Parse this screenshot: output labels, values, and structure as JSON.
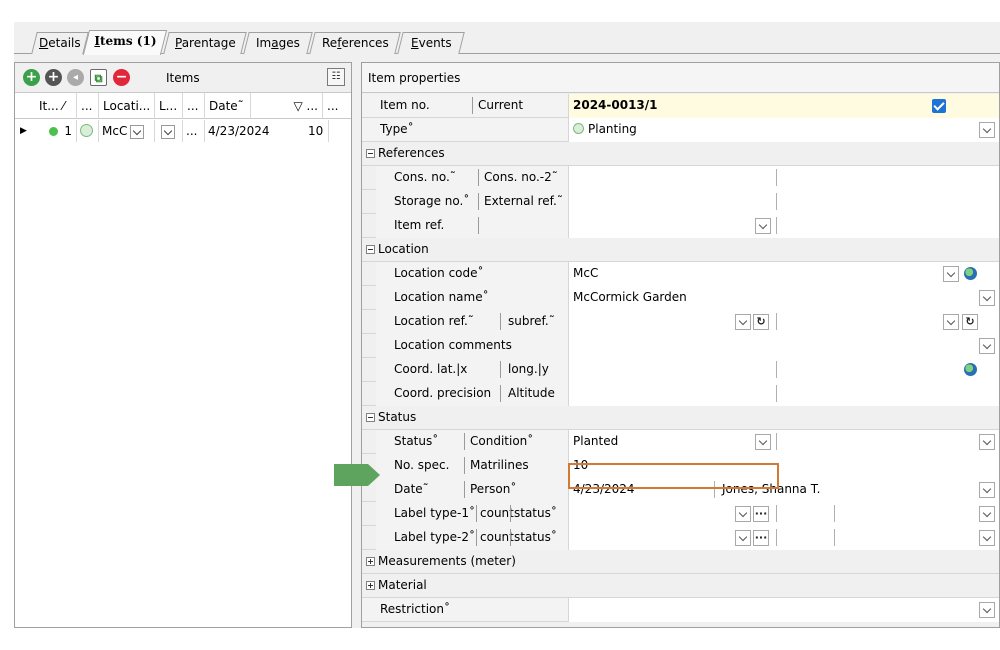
{
  "tabs": [
    {
      "label": "Details",
      "ul": "D"
    },
    {
      "label": "Items (1)",
      "ul": "I"
    },
    {
      "label": "Parentage",
      "ul": "P"
    },
    {
      "label": "Images",
      "ul": "a"
    },
    {
      "label": "References",
      "ul": "f"
    },
    {
      "label": "Events",
      "ul": "E"
    }
  ],
  "left": {
    "toolbar_label": "Items",
    "columns": [
      "It... ⁄",
      "...",
      "Locati...",
      "L...",
      "...",
      "Date˜",
      "▽ ...",
      "..."
    ],
    "row": {
      "num": "1",
      "loc": "McC",
      "ellipsis": "...",
      "date": "4/23/2024",
      "count": "10"
    }
  },
  "right": {
    "header": "Item properties",
    "item_no": {
      "label": "Item no.",
      "sub": "Current",
      "value": "2024-0013/1"
    },
    "type": {
      "label": "Type˚",
      "value": "Planting"
    },
    "references": {
      "title": "References",
      "cons": {
        "label": "Cons. no.˜",
        "sub": "Cons. no.-2˜"
      },
      "storage": {
        "label": "Storage no.˚",
        "sub": "External ref.˜"
      },
      "itemref": {
        "label": "Item ref."
      }
    },
    "location": {
      "title": "Location",
      "code": {
        "label": "Location code˚",
        "value": "McC"
      },
      "name": {
        "label": "Location name˚",
        "value": "McCormick Garden"
      },
      "ref": {
        "label": "Location ref.˜",
        "sub": "subref.˜"
      },
      "comments": {
        "label": "Location comments"
      },
      "coord": {
        "label": "Coord. lat.|x",
        "sub": "long.|y"
      },
      "precision": {
        "label": "Coord. precision",
        "sub": "Altitude"
      }
    },
    "status": {
      "title": "Status",
      "status": {
        "label": "Status˚",
        "sub": "Condition˚",
        "value": "Planted"
      },
      "spec": {
        "label": "No. spec.",
        "sub": "Matrilines",
        "value": "10"
      },
      "date": {
        "label": "Date˜",
        "sub": "Person˚",
        "value": "4/23/2024",
        "person": "Jones, Shanna T."
      },
      "label1": {
        "label": "Label type-1˚",
        "sub1": "count",
        "sub2": "status˚"
      },
      "label2": {
        "label": "Label type-2˚",
        "sub1": "count",
        "sub2": "status˚"
      }
    },
    "measurements": "Measurements (meter)",
    "material": "Material",
    "restriction": "Restriction˚"
  },
  "colors": {
    "accent_arrow": "#5ea35e",
    "focus_border": "#d07a36",
    "checkbox": "#1e74d6",
    "item_row_bg": "#fffbe0"
  }
}
